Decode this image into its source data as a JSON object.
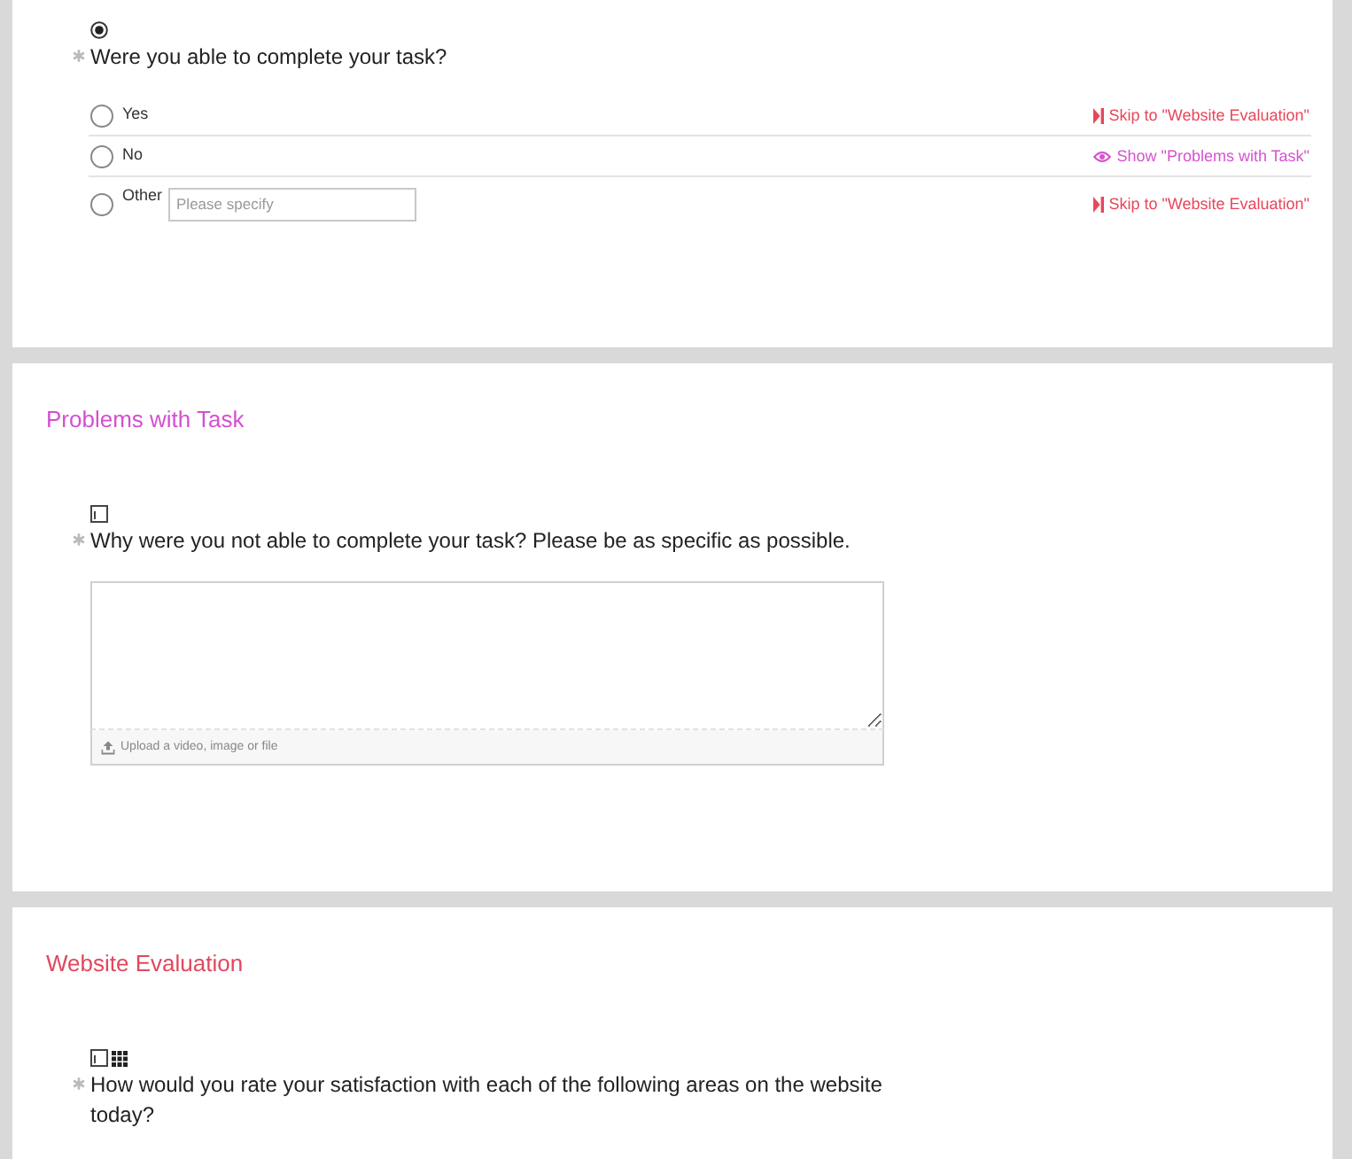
{
  "sections": [
    {
      "questions": [
        {
          "kind": "single_choice",
          "required": true,
          "text": "Were you able to complete your task?",
          "options": [
            {
              "label": "Yes",
              "selected": false,
              "logic": {
                "kind": "skip",
                "text": "Skip to \"Website Evaluation\""
              }
            },
            {
              "label": "No",
              "selected": false,
              "logic": {
                "kind": "show",
                "text": "Show \"Problems with Task\""
              }
            },
            {
              "label": "Other",
              "selected": false,
              "placeholder": "Please specify",
              "logic": {
                "kind": "skip",
                "text": "Skip to \"Website Evaluation\""
              }
            }
          ]
        }
      ]
    },
    {
      "title": "Problems with Task",
      "color": "#d44fcf",
      "questions": [
        {
          "kind": "long_text",
          "required": true,
          "text": "Why were you not able to complete your task? Please be as specific as possible.",
          "upload_label": "Upload a video, image or file"
        }
      ]
    },
    {
      "title": "Website Evaluation",
      "color": "#e0485e",
      "questions": [
        {
          "kind": "matrix",
          "required": true,
          "text": "How would you rate your satisfaction with each of the following areas on the website today?"
        }
      ]
    }
  ]
}
